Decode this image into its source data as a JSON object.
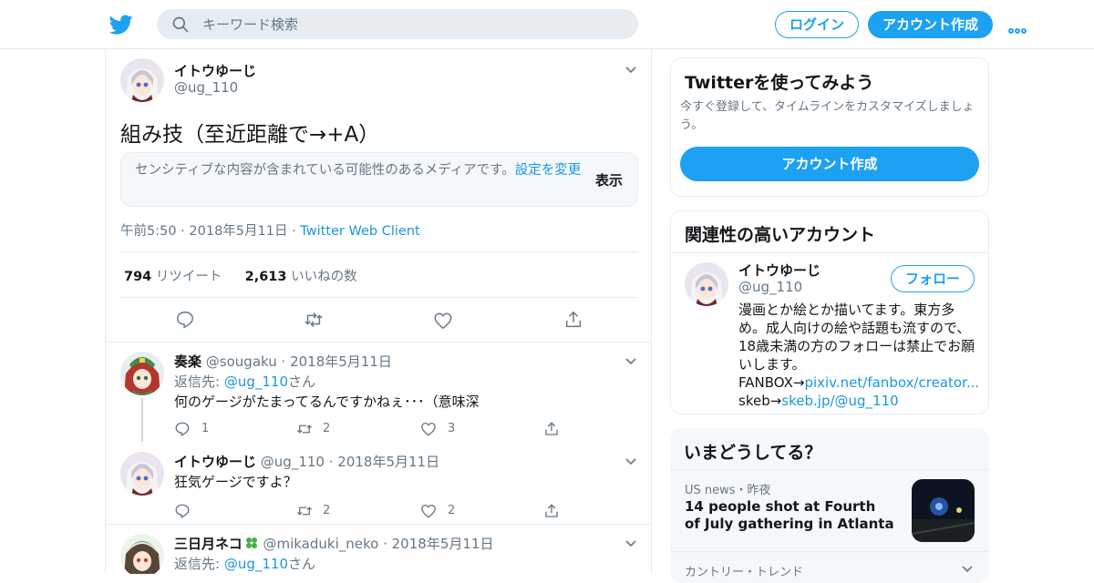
{
  "header": {
    "search_placeholder": "キーワード検索",
    "login_label": "ログイン",
    "signup_label": "アカウント作成"
  },
  "tweet": {
    "author_name": "イトウゆーじ",
    "author_handle": "@ug_110",
    "text": "組み技（至近距離で→+A）",
    "sensitive_notice": "センシティブな内容が含まれている可能性のあるメディアです。",
    "sensitive_settings_link": "設定を変更",
    "sensitive_show_label": "表示",
    "time": "午前5:50",
    "date": "2018年5月11日",
    "client": "Twitter Web Client",
    "retweet_count": "794",
    "retweet_label": "リツイート",
    "like_count": "2,613",
    "like_label": "いいねの数"
  },
  "replies": [
    {
      "name": "奏楽",
      "handle": "@sougaku",
      "date": "2018年5月11日",
      "reply_to_prefix": "返信先: ",
      "reply_to_handle": "@ug_110",
      "reply_to_suffix": "さん",
      "text": "何のゲージがたまってるんですかねぇ･･･（意味深",
      "replies": "1",
      "retweets": "2",
      "likes": "3"
    },
    {
      "name": "イトウゆーじ",
      "handle": "@ug_110",
      "date": "2018年5月11日",
      "text": "狂気ゲージですよ？",
      "replies": "",
      "retweets": "2",
      "likes": "2"
    },
    {
      "name": "三日月ネコ",
      "handle": "@mikaduki_neko",
      "date": "2018年5月11日",
      "reply_to_prefix": "返信先: ",
      "reply_to_handle": "@ug_110",
      "reply_to_suffix": "さん"
    }
  ],
  "sidebar": {
    "signup_card": {
      "title": "Twitterを使ってみよう",
      "subtitle": "今すぐ登録して、タイムラインをカスタマイズしましょう。",
      "button": "アカウント作成"
    },
    "related": {
      "title": "関連性の高いアカウント",
      "name": "イトウゆーじ",
      "handle": "@ug_110",
      "follow_label": "フォロー",
      "bio": "漫画とか絵とか描いてます。東方多め。成人向けの絵や話題も流すので、18歳未満の方のフォローは禁止でお願いします。",
      "fanbox_prefix": "FANBOX→",
      "fanbox_link": "pixiv.net/fanbox/creator...",
      "skeb_prefix": "skeb→",
      "skeb_link": "skeb.jp/@ug_110"
    },
    "trends": {
      "title": "いまどうしてる？",
      "items": [
        {
          "category": "US news・昨夜",
          "title": "14 people shot at Fourth of July gathering in Atlanta"
        },
        {
          "category": "カントリー・トレンド"
        }
      ]
    }
  },
  "colors": {
    "accent": "#1da1f2",
    "link": "#1b95e0",
    "text": "#14171a",
    "muted": "#657786",
    "border": "#e6ecf0"
  }
}
